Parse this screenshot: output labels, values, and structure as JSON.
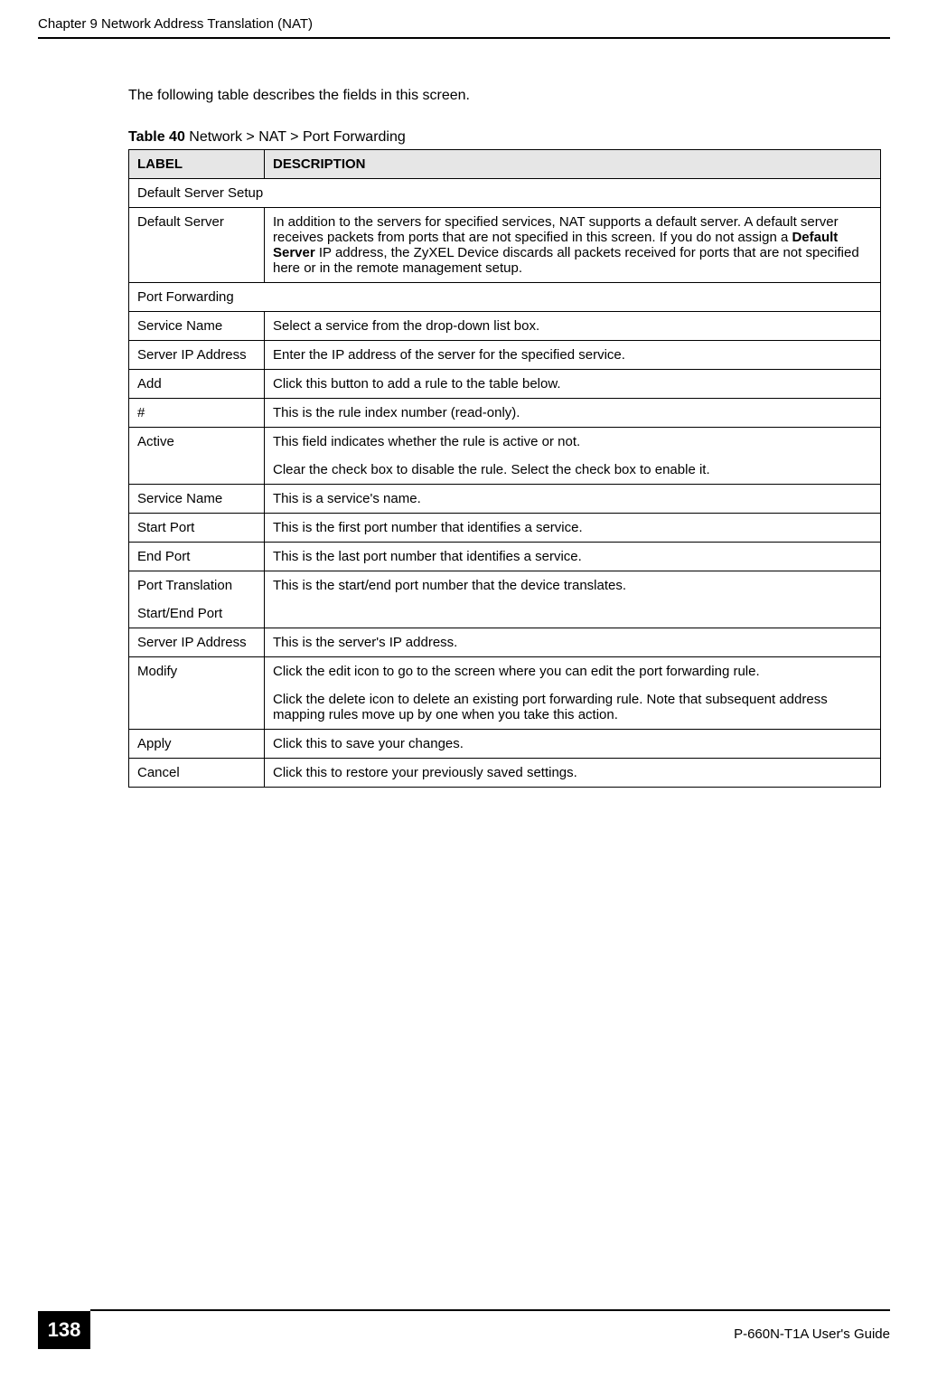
{
  "header": {
    "running": "Chapter 9 Network Address Translation (NAT)"
  },
  "intro": "The following table describes the fields in this screen.",
  "table": {
    "caption_prefix": "Table 40",
    "caption_rest": "   Network > NAT > Port Forwarding",
    "headers": {
      "label": "LABEL",
      "description": "DESCRIPTION"
    },
    "rows": [
      {
        "type": "section",
        "label": "Default Server Setup"
      },
      {
        "type": "row",
        "label": "Default Server",
        "desc_parts": [
          {
            "text": "In addition to the servers for specified services, NAT supports a default server. A default server receives packets from ports that are not specified in this screen. If you do not assign a "
          },
          {
            "text": "Default Server",
            "bold": true
          },
          {
            "text": " IP address, the ZyXEL Device discards all packets received for ports that are not specified here or in the remote management setup."
          }
        ]
      },
      {
        "type": "section",
        "label": "Port Forwarding"
      },
      {
        "type": "row",
        "label": "Service Name",
        "desc": "Select a service from the drop-down list box."
      },
      {
        "type": "row",
        "label": "Server IP Address",
        "desc": "Enter the IP address of the server for the specified service."
      },
      {
        "type": "row",
        "label": "Add",
        "desc": "Click this button to add a rule to the table below."
      },
      {
        "type": "row",
        "label": "#",
        "desc": "This is the rule index number (read-only)."
      },
      {
        "type": "row",
        "label": "Active",
        "desc_multi": [
          "This field indicates whether the rule is active or not.",
          "Clear the check box to disable the rule. Select the check box to enable it."
        ]
      },
      {
        "type": "row",
        "label": "Service Name",
        "desc": "This is a service's name."
      },
      {
        "type": "row",
        "label": "Start Port",
        "desc": "This is the first port number that identifies a service."
      },
      {
        "type": "row",
        "label": "End Port",
        "desc": "This is the last port number that identifies a service."
      },
      {
        "type": "row",
        "label_multi": [
          "Port Translation",
          "Start/End Port"
        ],
        "desc": "This is the start/end port number that the device translates."
      },
      {
        "type": "row",
        "label": "Server IP Address",
        "desc": "This is the server's IP address."
      },
      {
        "type": "row",
        "label": "Modify",
        "desc_multi": [
          "Click the edit icon to go to the screen where you can edit the port forwarding rule.",
          "Click the delete icon to delete an existing port forwarding rule. Note that subsequent address mapping rules move up by one when you take this action."
        ]
      },
      {
        "type": "row",
        "label": "Apply",
        "desc": "Click this to save your changes."
      },
      {
        "type": "row",
        "label": "Cancel",
        "desc": "Click this to restore your previously saved settings."
      }
    ]
  },
  "footer": {
    "page_number": "138",
    "guide": "P-660N-T1A User's Guide"
  }
}
